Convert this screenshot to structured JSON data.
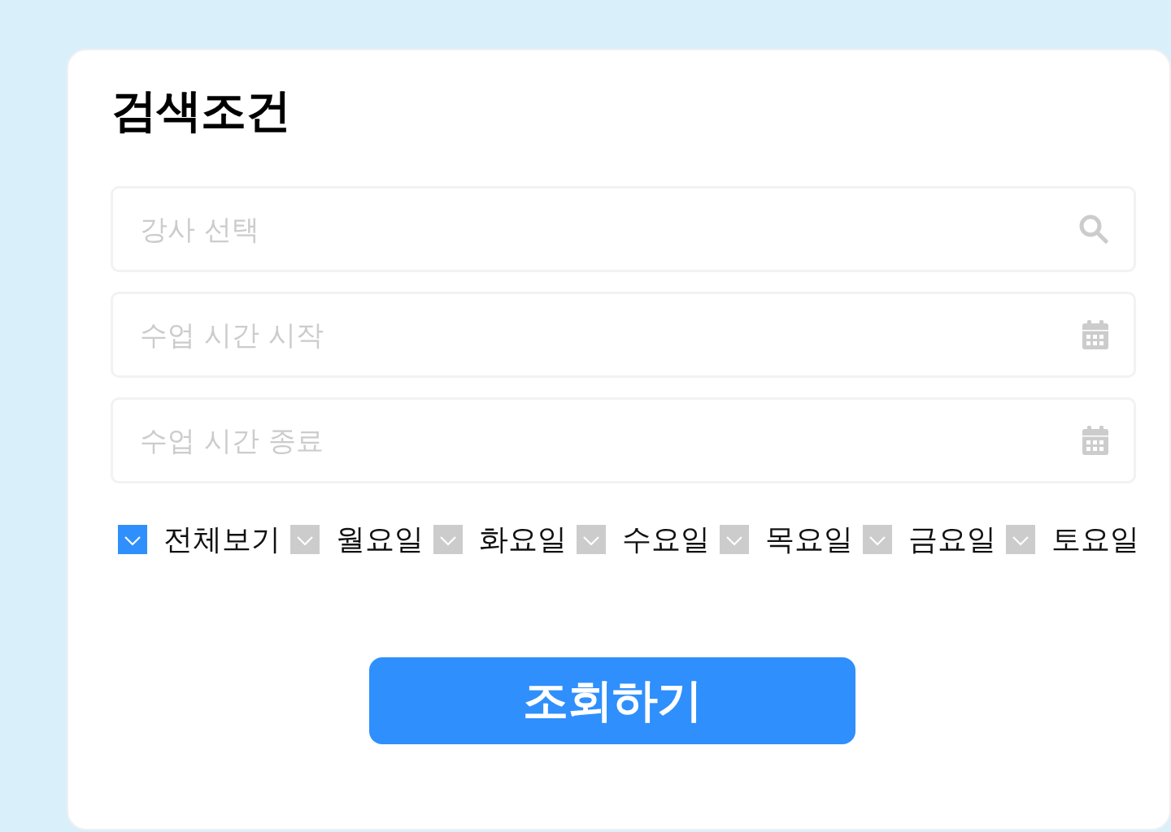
{
  "title": "검색조건",
  "fields": [
    {
      "kind": "search",
      "placeholder": "강사 선택"
    },
    {
      "kind": "date",
      "placeholder": "수업 시간 시작"
    },
    {
      "kind": "date",
      "placeholder": "수업 시간 종료"
    }
  ],
  "day_filters": [
    {
      "label": "전체보기",
      "checked": true
    },
    {
      "label": "월요일",
      "checked": false
    },
    {
      "label": "화요일",
      "checked": false
    },
    {
      "label": "수요일",
      "checked": false
    },
    {
      "label": "목요일",
      "checked": false
    },
    {
      "label": "금요일",
      "checked": false
    },
    {
      "label": "토요일",
      "checked": false
    }
  ],
  "submit_button": {
    "label": "조회하기"
  }
}
